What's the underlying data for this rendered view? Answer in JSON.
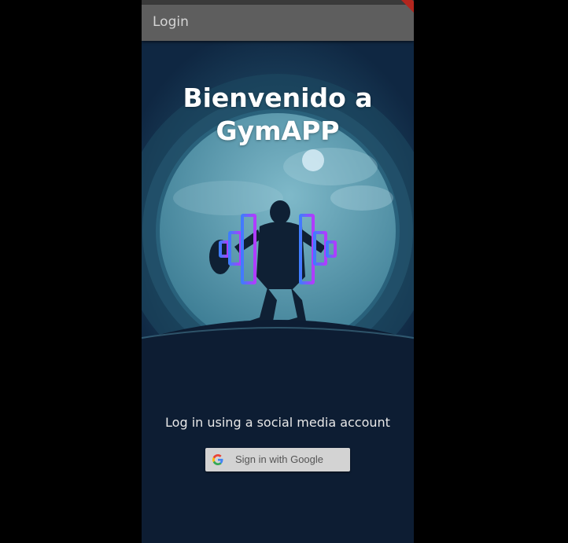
{
  "app_bar": {
    "title": "Login"
  },
  "welcome": {
    "line1": "Bienvenido a",
    "line2": "GymAPP"
  },
  "social": {
    "caption": "Log in using a social media account",
    "google_button_label": "Sign in with Google"
  },
  "colors": {
    "app_bar": "#5e5e5e",
    "background": "#0d1d33",
    "moon": "#5a9aae",
    "dumbbell_start": "#3f7cff",
    "dumbbell_end": "#b23bff"
  },
  "icons": {
    "google": "google-g-icon",
    "dumbbell": "dumbbell-icon"
  }
}
